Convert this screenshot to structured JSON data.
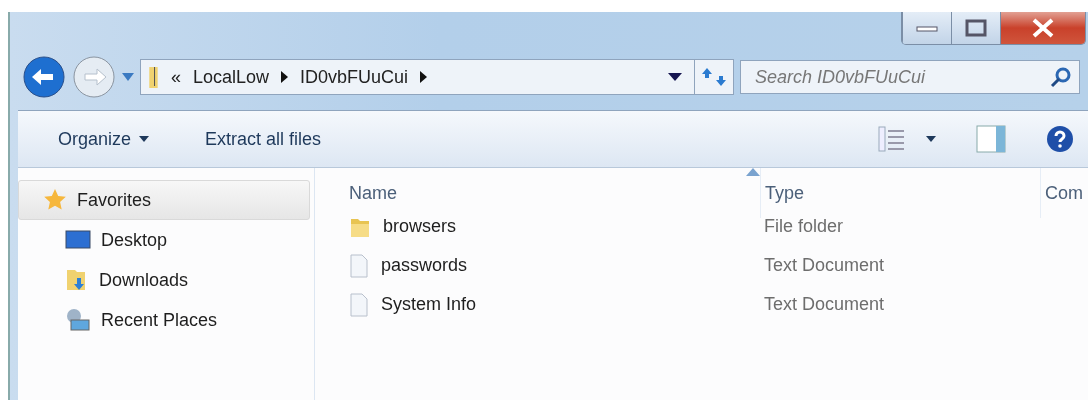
{
  "address_bar": {
    "overflow": "«",
    "crumbs": [
      "LocalLow",
      "ID0vbFUuCui"
    ]
  },
  "search": {
    "placeholder": "Search ID0vbFUuCui"
  },
  "toolbar": {
    "buttons": [
      {
        "label": "Organize",
        "dropdown": true
      },
      {
        "label": "Extract all files",
        "dropdown": false
      }
    ]
  },
  "sidebar": {
    "items": [
      {
        "label": "Favorites",
        "kind": "star",
        "selected": true,
        "children": [
          {
            "label": "Desktop",
            "kind": "desktop",
            "selected": false
          },
          {
            "label": "Downloads",
            "kind": "downloads",
            "selected": false
          },
          {
            "label": "Recent Places",
            "kind": "recent",
            "selected": false
          }
        ]
      }
    ]
  },
  "table": {
    "columns": [
      "Name",
      "Type",
      "Com"
    ],
    "rows": [
      {
        "name": "browsers",
        "kind": "folder",
        "type": "File folder"
      },
      {
        "name": "passwords",
        "kind": "text",
        "type": "Text Document"
      },
      {
        "name": "System Info",
        "kind": "text",
        "type": "Text Document"
      }
    ]
  }
}
